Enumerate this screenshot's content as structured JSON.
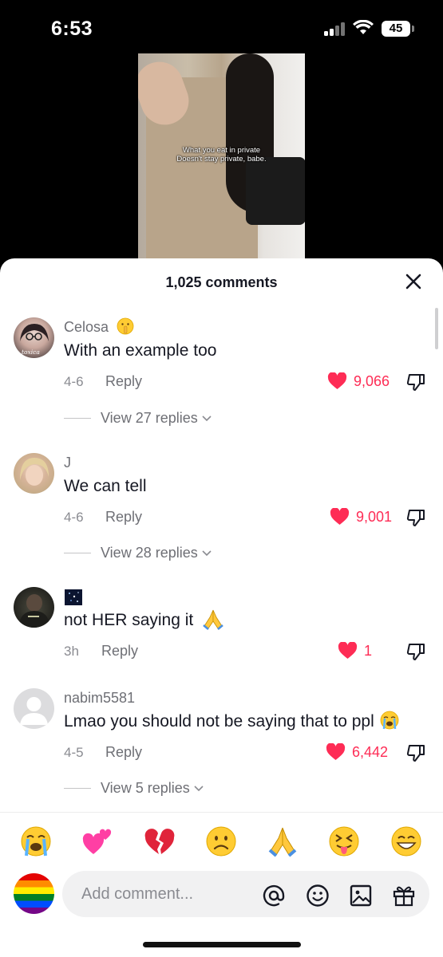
{
  "status_bar": {
    "time": "6:53",
    "battery": "45"
  },
  "video": {
    "caption_line1": "What you eat in private",
    "caption_line2": "Doesn't stay private, babe."
  },
  "sheet": {
    "title": "1,025 comments"
  },
  "comments": [
    {
      "username": "Celosa",
      "username_emoji": "shushing-face",
      "avatar_label": "toxica",
      "text": "With an example too",
      "date": "4-6",
      "reply": "Reply",
      "likes": "9,066",
      "view_replies": "View 27 replies"
    },
    {
      "username": "J",
      "text": "We can tell",
      "date": "4-6",
      "reply": "Reply",
      "likes": "9,001",
      "view_replies": "View 28 replies"
    },
    {
      "username": "",
      "text": "not HER saying it",
      "text_emoji": "folded-hands",
      "date": "3h",
      "reply": "Reply",
      "likes": "1"
    },
    {
      "username": "nabim5581",
      "text": "Lmao you should not be saying that to ppl",
      "text_emoji": "loudly-crying-face",
      "date": "4-5",
      "reply": "Reply",
      "likes": "6,442",
      "view_replies": "View 5 replies"
    }
  ],
  "emoji_bar": [
    "loudly-crying-face",
    "two-hearts",
    "broken-heart",
    "frowning-face",
    "folded-hands",
    "squinting-tongue-face",
    "grinning-face"
  ],
  "composer": {
    "placeholder": "Add comment..."
  },
  "colors": {
    "like_red": "#fe2c55",
    "text": "#161823",
    "secondary": "#6e6f75"
  }
}
